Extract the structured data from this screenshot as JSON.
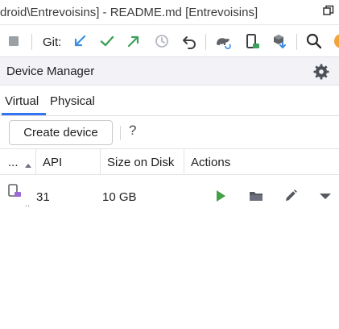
{
  "window": {
    "title": "droid\\Entrevoisins] - README.md [Entrevoisins]"
  },
  "toolbar": {
    "git_label": "Git:",
    "icons": [
      "stop-icon",
      "git-update-icon",
      "git-commit-icon",
      "git-push-icon",
      "history-icon",
      "rollback-icon",
      "sync-gradle-icon",
      "device-manager-icon",
      "sdk-manager-icon",
      "search-icon"
    ]
  },
  "panel": {
    "title": "Device Manager"
  },
  "tabs": [
    {
      "label": "Virtual",
      "selected": true
    },
    {
      "label": "Physical",
      "selected": false
    }
  ],
  "actions": {
    "create_label": "Create device",
    "help_label": "?"
  },
  "table": {
    "columns": [
      "...",
      "API",
      "Size on Disk",
      "Actions"
    ],
    "rows": [
      {
        "api": "31",
        "size": "10 GB",
        "dots": ".."
      }
    ]
  },
  "colors": {
    "accent": "#3574f0",
    "run_green": "#43a047",
    "vcs_blue": "#3a8de0",
    "vcs_green": "#3ea05a",
    "icon_gray": "#6c707e"
  }
}
